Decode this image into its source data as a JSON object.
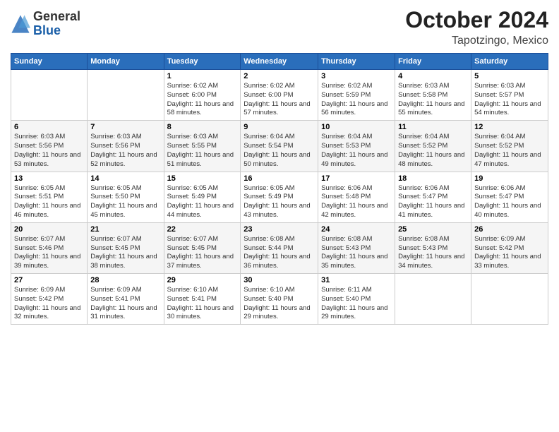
{
  "header": {
    "logo_general": "General",
    "logo_blue": "Blue",
    "month_title": "October 2024",
    "location": "Tapotzingo, Mexico"
  },
  "days_of_week": [
    "Sunday",
    "Monday",
    "Tuesday",
    "Wednesday",
    "Thursday",
    "Friday",
    "Saturday"
  ],
  "weeks": [
    [
      {
        "day": null,
        "info": null
      },
      {
        "day": null,
        "info": null
      },
      {
        "day": "1",
        "info": "Sunrise: 6:02 AM\nSunset: 6:00 PM\nDaylight: 11 hours and 58 minutes."
      },
      {
        "day": "2",
        "info": "Sunrise: 6:02 AM\nSunset: 6:00 PM\nDaylight: 11 hours and 57 minutes."
      },
      {
        "day": "3",
        "info": "Sunrise: 6:02 AM\nSunset: 5:59 PM\nDaylight: 11 hours and 56 minutes."
      },
      {
        "day": "4",
        "info": "Sunrise: 6:03 AM\nSunset: 5:58 PM\nDaylight: 11 hours and 55 minutes."
      },
      {
        "day": "5",
        "info": "Sunrise: 6:03 AM\nSunset: 5:57 PM\nDaylight: 11 hours and 54 minutes."
      }
    ],
    [
      {
        "day": "6",
        "info": "Sunrise: 6:03 AM\nSunset: 5:56 PM\nDaylight: 11 hours and 53 minutes."
      },
      {
        "day": "7",
        "info": "Sunrise: 6:03 AM\nSunset: 5:56 PM\nDaylight: 11 hours and 52 minutes."
      },
      {
        "day": "8",
        "info": "Sunrise: 6:03 AM\nSunset: 5:55 PM\nDaylight: 11 hours and 51 minutes."
      },
      {
        "day": "9",
        "info": "Sunrise: 6:04 AM\nSunset: 5:54 PM\nDaylight: 11 hours and 50 minutes."
      },
      {
        "day": "10",
        "info": "Sunrise: 6:04 AM\nSunset: 5:53 PM\nDaylight: 11 hours and 49 minutes."
      },
      {
        "day": "11",
        "info": "Sunrise: 6:04 AM\nSunset: 5:52 PM\nDaylight: 11 hours and 48 minutes."
      },
      {
        "day": "12",
        "info": "Sunrise: 6:04 AM\nSunset: 5:52 PM\nDaylight: 11 hours and 47 minutes."
      }
    ],
    [
      {
        "day": "13",
        "info": "Sunrise: 6:05 AM\nSunset: 5:51 PM\nDaylight: 11 hours and 46 minutes."
      },
      {
        "day": "14",
        "info": "Sunrise: 6:05 AM\nSunset: 5:50 PM\nDaylight: 11 hours and 45 minutes."
      },
      {
        "day": "15",
        "info": "Sunrise: 6:05 AM\nSunset: 5:49 PM\nDaylight: 11 hours and 44 minutes."
      },
      {
        "day": "16",
        "info": "Sunrise: 6:05 AM\nSunset: 5:49 PM\nDaylight: 11 hours and 43 minutes."
      },
      {
        "day": "17",
        "info": "Sunrise: 6:06 AM\nSunset: 5:48 PM\nDaylight: 11 hours and 42 minutes."
      },
      {
        "day": "18",
        "info": "Sunrise: 6:06 AM\nSunset: 5:47 PM\nDaylight: 11 hours and 41 minutes."
      },
      {
        "day": "19",
        "info": "Sunrise: 6:06 AM\nSunset: 5:47 PM\nDaylight: 11 hours and 40 minutes."
      }
    ],
    [
      {
        "day": "20",
        "info": "Sunrise: 6:07 AM\nSunset: 5:46 PM\nDaylight: 11 hours and 39 minutes."
      },
      {
        "day": "21",
        "info": "Sunrise: 6:07 AM\nSunset: 5:45 PM\nDaylight: 11 hours and 38 minutes."
      },
      {
        "day": "22",
        "info": "Sunrise: 6:07 AM\nSunset: 5:45 PM\nDaylight: 11 hours and 37 minutes."
      },
      {
        "day": "23",
        "info": "Sunrise: 6:08 AM\nSunset: 5:44 PM\nDaylight: 11 hours and 36 minutes."
      },
      {
        "day": "24",
        "info": "Sunrise: 6:08 AM\nSunset: 5:43 PM\nDaylight: 11 hours and 35 minutes."
      },
      {
        "day": "25",
        "info": "Sunrise: 6:08 AM\nSunset: 5:43 PM\nDaylight: 11 hours and 34 minutes."
      },
      {
        "day": "26",
        "info": "Sunrise: 6:09 AM\nSunset: 5:42 PM\nDaylight: 11 hours and 33 minutes."
      }
    ],
    [
      {
        "day": "27",
        "info": "Sunrise: 6:09 AM\nSunset: 5:42 PM\nDaylight: 11 hours and 32 minutes."
      },
      {
        "day": "28",
        "info": "Sunrise: 6:09 AM\nSunset: 5:41 PM\nDaylight: 11 hours and 31 minutes."
      },
      {
        "day": "29",
        "info": "Sunrise: 6:10 AM\nSunset: 5:41 PM\nDaylight: 11 hours and 30 minutes."
      },
      {
        "day": "30",
        "info": "Sunrise: 6:10 AM\nSunset: 5:40 PM\nDaylight: 11 hours and 29 minutes."
      },
      {
        "day": "31",
        "info": "Sunrise: 6:11 AM\nSunset: 5:40 PM\nDaylight: 11 hours and 29 minutes."
      },
      {
        "day": null,
        "info": null
      },
      {
        "day": null,
        "info": null
      }
    ]
  ]
}
